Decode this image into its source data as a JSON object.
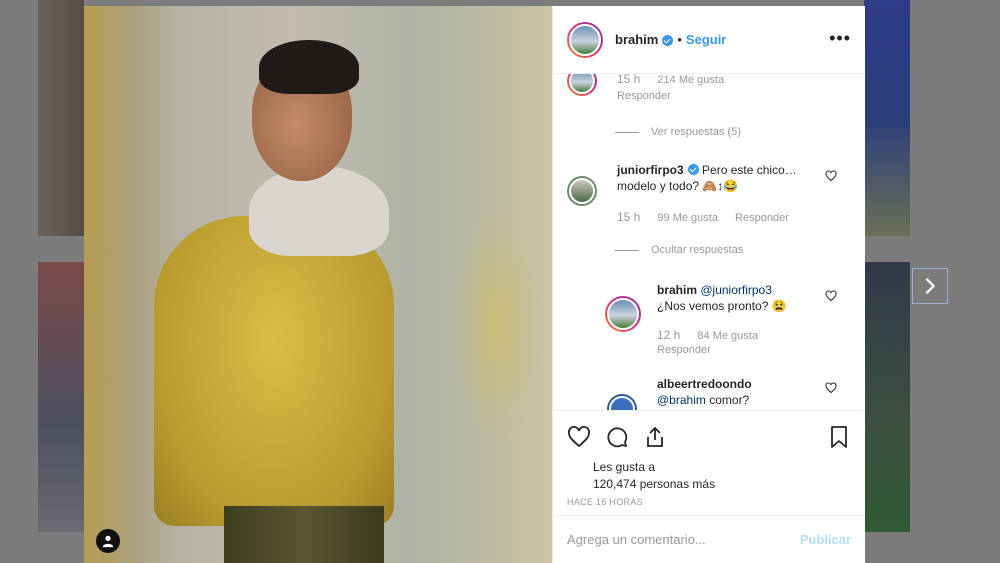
{
  "post": {
    "username": "brahim",
    "follow_label": "Seguir",
    "separator": "•",
    "more_label": "•••"
  },
  "comments": {
    "first": {
      "time": "15 h",
      "likes": "214 Me gusta",
      "reply": "Responder"
    },
    "view_replies": "Ver respuestas (5)",
    "juniorfirpo": {
      "username": "juniorfirpo3",
      "text": "Pero este chico… modelo y todo? 🙈↕😂",
      "time": "15 h",
      "likes": "99 Me gusta",
      "reply": "Responder"
    },
    "hide_replies": "Ocultar respuestas",
    "brahim_reply": {
      "username": "brahim",
      "mention": "@juniorfirpo3",
      "text": "¿Nos vemos pronto? 😫",
      "time": "12 h",
      "likes": "84 Me gusta",
      "reply": "Responder"
    },
    "albeert": {
      "username": "albeertredoondo",
      "mention": "@brahim",
      "text": "comor?"
    }
  },
  "actions": {
    "likes_prefix": "Les gusta a",
    "likes_count": "120,474 personas más",
    "timestamp": "HACE 16 HORAS"
  },
  "comment_box": {
    "placeholder": "Agrega un comentario...",
    "publish_label": "Publicar"
  },
  "icons": {
    "heart": "heart-icon",
    "comment": "comment-icon",
    "share": "share-icon",
    "bookmark": "bookmark-icon",
    "next": "chevron-right-icon",
    "user_tag": "user-tag-icon"
  },
  "colors": {
    "link_blue": "#3897f0",
    "publish_disabled": "#b2dffc",
    "muted": "#999999",
    "text": "#262626"
  }
}
